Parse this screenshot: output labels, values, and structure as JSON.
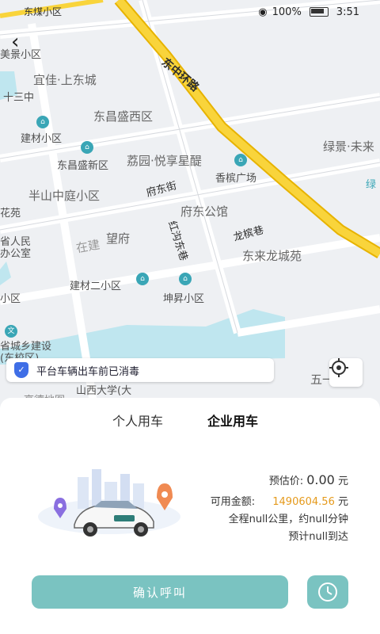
{
  "status_bar": {
    "left_label": "东煤小区",
    "battery": "100%",
    "time": "3:51"
  },
  "map": {
    "roads": {
      "east_ring": "东中环路",
      "fudong": "府东街",
      "honggou": "红沟东巷",
      "longbin": "龙槟巷"
    },
    "pois": {
      "meijing": "美景小区",
      "yijia": "宜佳·上东城",
      "shisan": "十三中",
      "dongchang_west": "东昌盛西区",
      "jiancai": "建材小区",
      "dongchang_new": "东昌盛新区",
      "liyuan": "荔园·悦享星醍",
      "lvjing": "绿景·未来",
      "xiangbin": "香槟广场",
      "banshan": "半山中庭小区",
      "fudong_office": "府东公馆",
      "huayuan": "花苑",
      "provincial": "省人民\n办公室",
      "wangfu": "望府",
      "zaijian": "在建",
      "donglai": "东来龙城苑",
      "jiancai2": "建材二小区",
      "kunsheng": "坤昇小区",
      "xiaoqu": "小区",
      "construction": "省城乡建设\n(东校区)",
      "shanxi_univ": "山西大学(大",
      "amap": "高德地图",
      "wuyi": "五一",
      "lv": "绿"
    }
  },
  "notice": {
    "text": "平台车辆出车前已消毒"
  },
  "panel": {
    "tabs": [
      "个人用车",
      "企业用车"
    ],
    "estimate_label": "预估价:",
    "estimate_value": "0.00",
    "estimate_unit": "元",
    "balance_label": "可用金额:",
    "balance_value": "1490604.56",
    "balance_unit": "元",
    "trip_line": "全程null公里，约null分钟",
    "arrive_line": "预计null到达",
    "confirm_label": "确认呼叫"
  }
}
